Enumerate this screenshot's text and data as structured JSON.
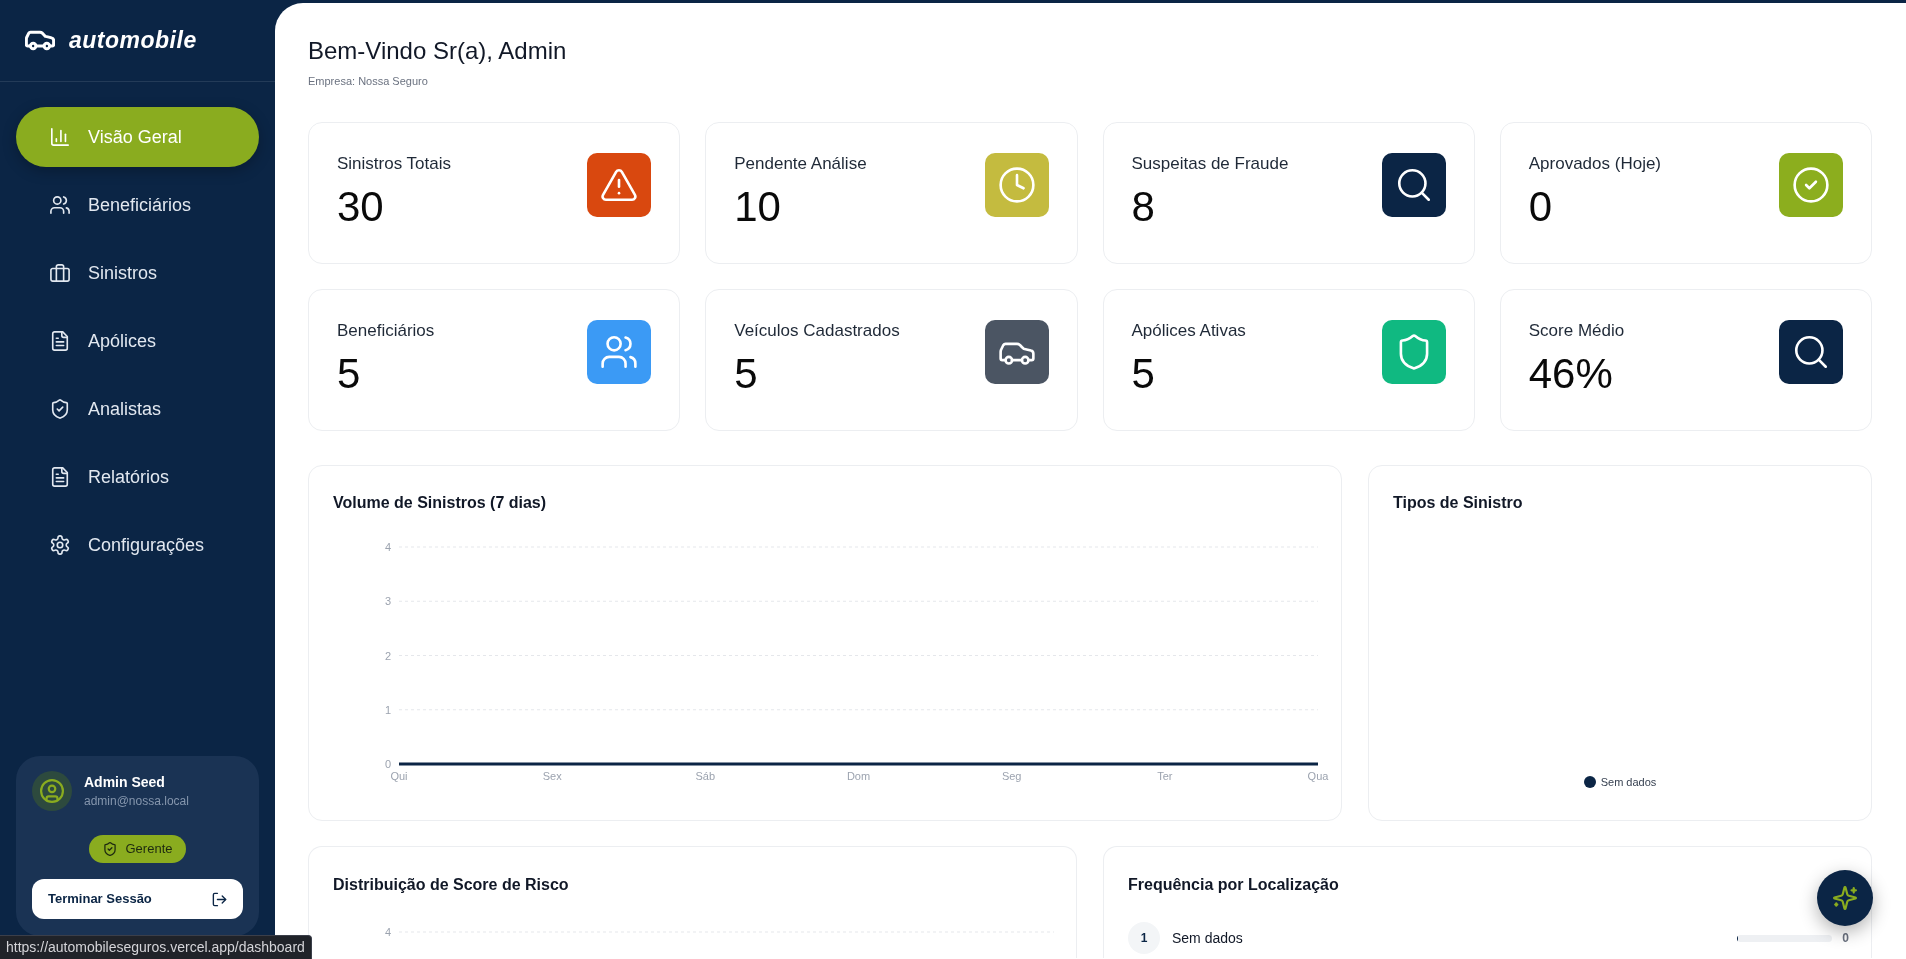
{
  "sidebar": {
    "logo": "automobile",
    "items": [
      {
        "label": "Visão Geral",
        "selected": true
      },
      {
        "label": "Beneficiários",
        "selected": false
      },
      {
        "label": "Sinistros",
        "selected": false
      },
      {
        "label": "Apólices",
        "selected": false
      },
      {
        "label": "Analistas",
        "selected": false
      },
      {
        "label": "Relatórios",
        "selected": false
      },
      {
        "label": "Configurações",
        "selected": false
      }
    ],
    "user": {
      "name": "Admin Seed",
      "email": "admin@nossa.local",
      "role": "Gerente",
      "logout": "Terminar Sessão"
    }
  },
  "header": {
    "title": "Bem-Vindo Sr(a), Admin",
    "subtitle": "Empresa: Nossa Seguro"
  },
  "stats": [
    {
      "label": "Sinistros Totais",
      "value": "30",
      "color": "#d9480f"
    },
    {
      "label": "Pendente Análise",
      "value": "10",
      "color": "#c4bb3f"
    },
    {
      "label": "Suspeitas de Fraude",
      "value": "8",
      "color": "#0b2545"
    },
    {
      "label": "Aprovados (Hoje)",
      "value": "0",
      "color": "#8cae1e"
    },
    {
      "label": "Beneficiários",
      "value": "5",
      "color": "#3b9af5"
    },
    {
      "label": "Veículos Cadastrados",
      "value": "5",
      "color": "#4b5563"
    },
    {
      "label": "Apólices Ativas",
      "value": "5",
      "color": "#10b981"
    },
    {
      "label": "Score Médio",
      "value": "46%",
      "color": "#0b2545"
    }
  ],
  "volume_chart": {
    "chart_data": {
      "type": "line",
      "title": "Volume de Sinistros (7 dias)",
      "categories": [
        "Qui",
        "Sex",
        "Sáb",
        "Dom",
        "Seg",
        "Ter",
        "Qua"
      ],
      "series": [
        {
          "color": "#0b2545",
          "values": [
            0,
            0,
            0,
            0,
            0,
            0,
            0
          ]
        }
      ],
      "ylim": [
        0,
        4
      ],
      "yticks": [
        0,
        1,
        2,
        3,
        4
      ],
      "grid": true
    }
  },
  "types_chart": {
    "title": "Tipos de Sinistro",
    "legend": [
      {
        "label": "Sem dados",
        "color": "#0b2545"
      }
    ]
  },
  "score_chart": {
    "title": "Distribuição de Score de Risco",
    "y_tick_labels": [
      "4"
    ]
  },
  "location_frequency": {
    "title": "Frequência por Localização",
    "rows": [
      {
        "rank": "1",
        "label": "Sem dados",
        "level": 0,
        "value": "0"
      }
    ]
  },
  "browser_status": {
    "url": "https://automobileseguros.vercel.app/dashboard"
  }
}
